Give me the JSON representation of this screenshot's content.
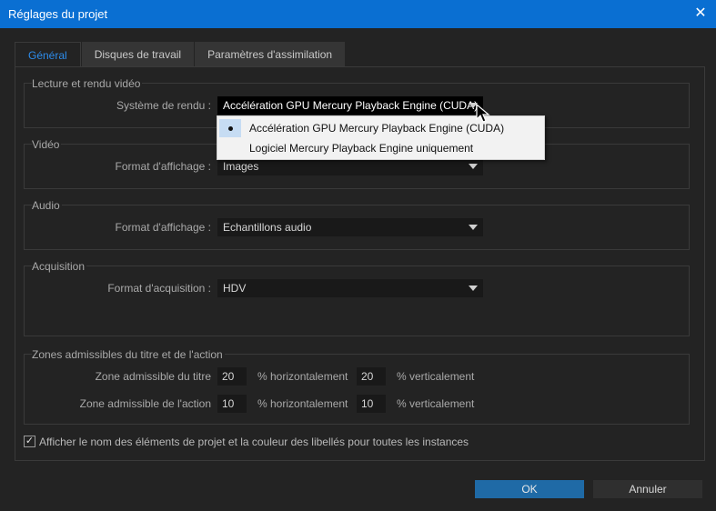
{
  "window": {
    "title": "Réglages du projet",
    "close_symbol": "✕"
  },
  "tabs": [
    {
      "label": "Général",
      "active": true
    },
    {
      "label": "Disques de travail",
      "active": false
    },
    {
      "label": "Paramètres d'assimilation",
      "active": false
    }
  ],
  "playback": {
    "title": "Lecture et rendu vidéo",
    "renderer_label": "Système de rendu :",
    "renderer_value": "Accélération GPU Mercury Playback Engine (CUDA)",
    "options": [
      {
        "label": "Accélération GPU Mercury Playback Engine (CUDA)",
        "selected": true
      },
      {
        "label": "Logiciel Mercury Playback Engine uniquement",
        "selected": false
      }
    ]
  },
  "video": {
    "title": "Vidéo",
    "format_label": "Format d'affichage :",
    "format_value": "Images"
  },
  "audio": {
    "title": "Audio",
    "format_label": "Format d'affichage :",
    "format_value": "Echantillons audio"
  },
  "acquisition": {
    "title": "Acquisition",
    "format_label": "Format d'acquisition :",
    "format_value": "HDV"
  },
  "safe_zones": {
    "title": "Zones admissibles du titre et de l'action",
    "title_zone_label": "Zone admissible du titre",
    "action_zone_label": "Zone admissible de l'action",
    "title_h": "20",
    "title_v": "20",
    "action_h": "10",
    "action_v": "10",
    "h_unit": "% horizontalement",
    "v_unit": "% verticalement"
  },
  "show_names": {
    "checked": true,
    "check_symbol": "✓",
    "label": "Afficher le nom des éléments de projet et la couleur des libellés pour toutes les instances"
  },
  "buttons": {
    "ok": "OK",
    "cancel": "Annuler"
  },
  "colors": {
    "titlebar": "#0a6fd2",
    "accent": "#2d8ceb",
    "ok_button": "#1f6aa6",
    "background": "#232323"
  }
}
